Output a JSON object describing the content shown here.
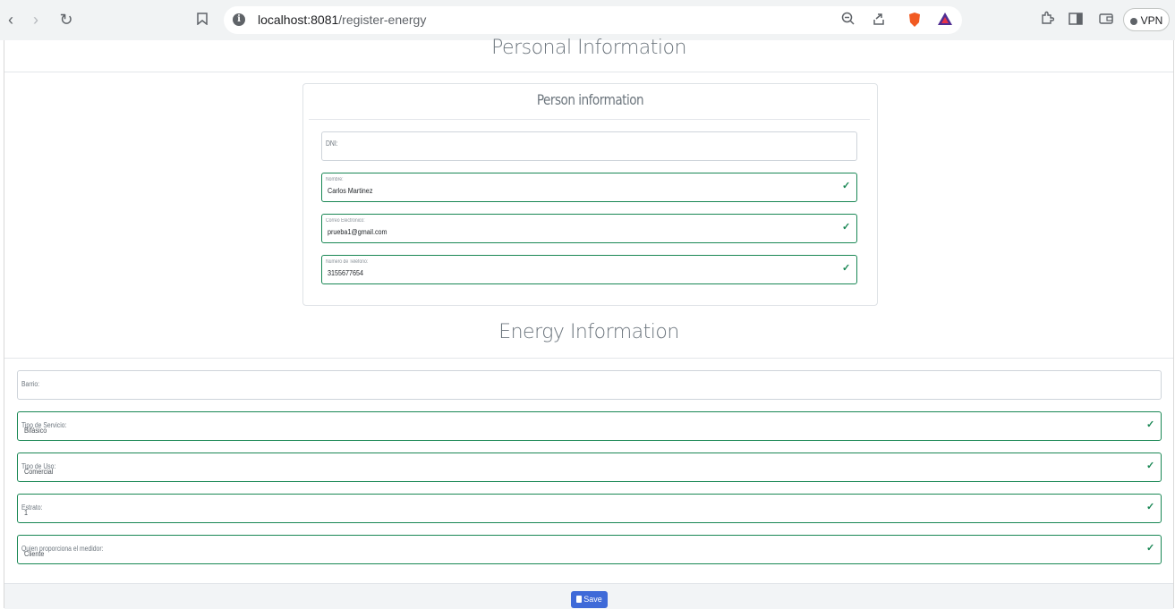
{
  "browser": {
    "url_host": "localhost:8081",
    "url_path": "/register-energy",
    "vpn_label": "VPN"
  },
  "personal_section": {
    "title": "Personal Information",
    "card_title": "Person information",
    "fields": [
      {
        "label": "DNI:",
        "value": "",
        "valid": false
      },
      {
        "label": "Nombre:",
        "value": "Carlos Martinez",
        "valid": true
      },
      {
        "label": "Correo Electrónico:",
        "value": "prueba1@gmail.com",
        "valid": true
      },
      {
        "label": "Número de Teléfono:",
        "value": "3155677654",
        "valid": true
      }
    ]
  },
  "energy_section": {
    "title": "Energy Information",
    "fields": [
      {
        "label": "Barrio:",
        "value": "",
        "valid": false
      },
      {
        "label": "Tipo de Servicio:",
        "value": "Bifásico",
        "valid": true
      },
      {
        "label": "Tipo de Uso:",
        "value": "Comercial",
        "valid": true
      },
      {
        "label": "Estrato:",
        "value": "1",
        "valid": true
      },
      {
        "label": "Quien proporciona el medidor:",
        "value": "Cliente",
        "valid": true
      }
    ]
  },
  "actions": {
    "save_label": "Save"
  },
  "colors": {
    "valid_border": "#198754",
    "primary_button": "#3f6ad8"
  },
  "icons": [
    "back-icon",
    "forward-icon",
    "reload-icon",
    "bookmark-icon",
    "info-icon",
    "zoom-out-icon",
    "share-icon",
    "brave-shield-icon",
    "brave-rewards-icon",
    "extensions-icon",
    "sidebar-icon",
    "wallet-icon",
    "check-icon",
    "document-icon"
  ]
}
